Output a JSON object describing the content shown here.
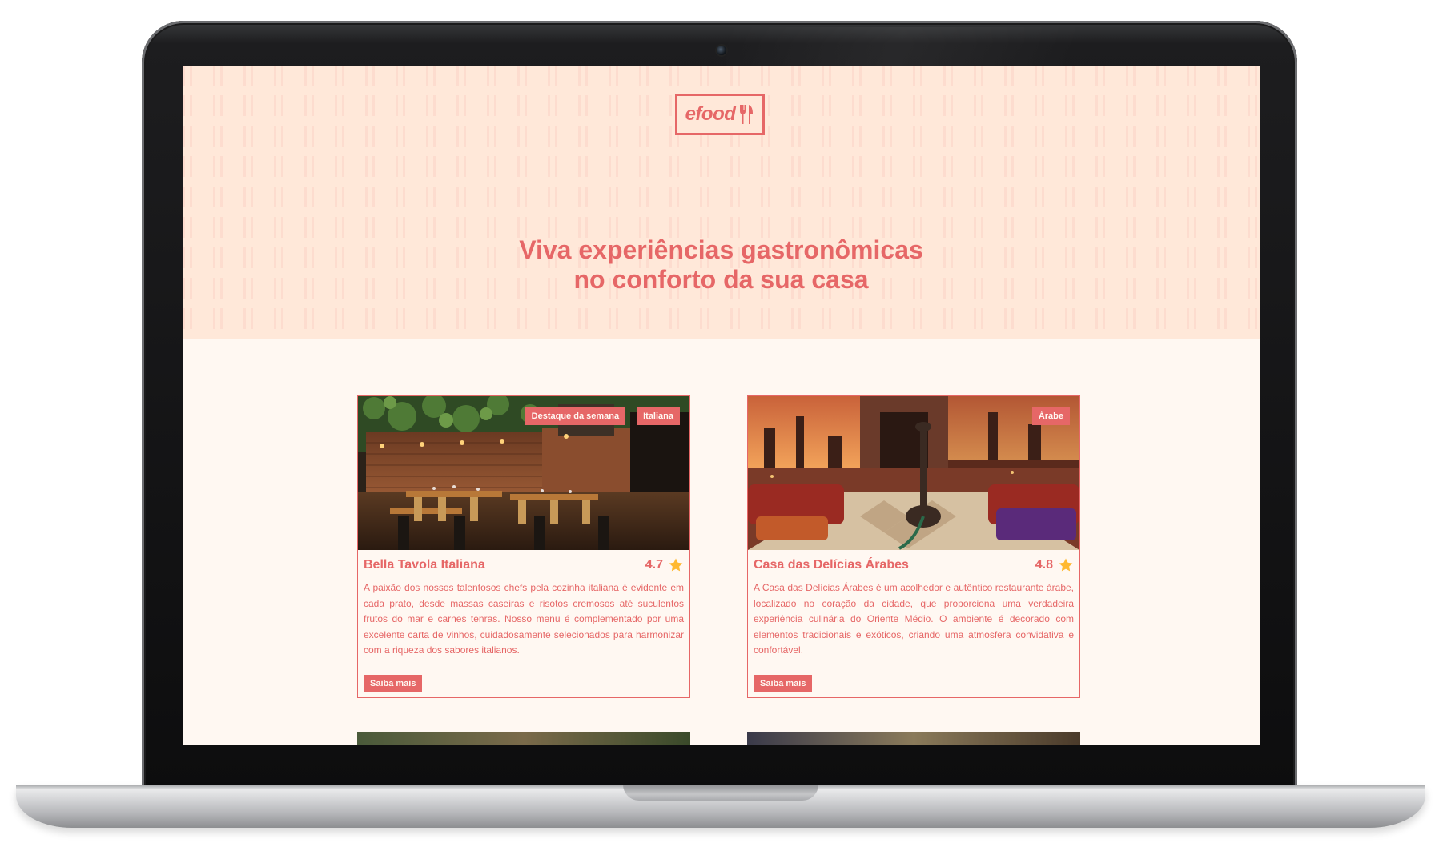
{
  "brand": {
    "logo_text": "efood",
    "accent": "#e66767",
    "hero_bg": "#ffe8d9",
    "page_bg": "#fff8f2"
  },
  "hero": {
    "title_line1": "Viva experiências gastronômicas",
    "title_line2": "no conforto da sua casa"
  },
  "restaurants": [
    {
      "name": "Bella Tavola Italiana",
      "rating": "4.7",
      "tags": [
        "Destaque da semana",
        "Italiana"
      ],
      "description": "A paixão dos nossos talentosos chefs pela cozinha italiana é evidente em cada prato, desde massas caseiras e risotos cremosos até suculentos frutos do mar e carnes tenras. Nosso menu é complementado por uma excelente carta de vinhos, cuidadosamente selecionados para harmonizar com a riqueza dos sabores italianos.",
      "button": "Saiba mais"
    },
    {
      "name": "Casa das Delícias Árabes",
      "rating": "4.8",
      "tags": [
        "Árabe"
      ],
      "description": "A Casa das Delícias Árabes é um acolhedor e autêntico restaurante árabe, localizado no coração da cidade, que proporciona uma verdadeira experiência culinária do Oriente Médio. O ambiente é decorado com elementos tradicionais e exóticos, criando uma atmosfera convidativa e confortável.",
      "button": "Saiba mais"
    }
  ],
  "icons": {
    "star": "star-icon",
    "cutlery": "cutlery-icon",
    "camera": "camera-icon"
  }
}
